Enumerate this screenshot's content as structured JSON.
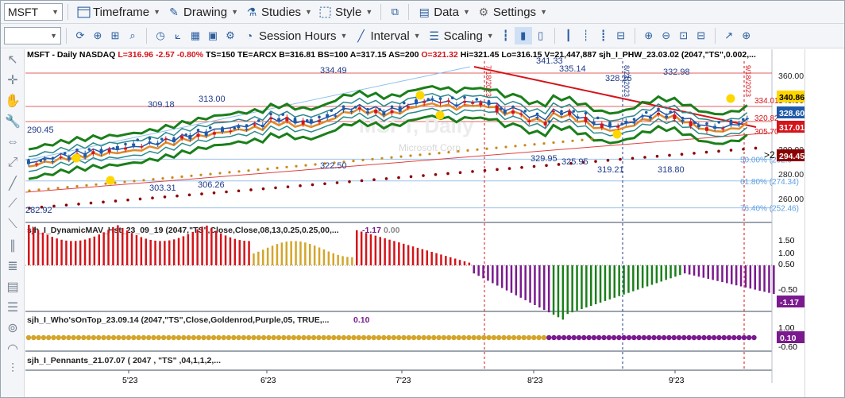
{
  "toolbar": {
    "symbol": "MSFT",
    "timeframe_label": "Timeframe",
    "drawing_label": "Drawing",
    "studies_label": "Studies",
    "style_label": "Style",
    "data_label": "Data",
    "settings_label": "Settings",
    "session_hours_label": "Session Hours",
    "interval_label": "Interval",
    "scaling_label": "Scaling"
  },
  "main_header": {
    "symbol": "MSFT - Daily  NASDAQ",
    "last": "L=316.96",
    "chg": "-2.57",
    "pct": "-0.80%",
    "ts": "TS=150",
    "te": "TE=ARCX",
    "bid": "B=316.81",
    "bs": "BS=100",
    "ask": "A=317.15",
    "as": "AS=200",
    "open": "O=321.32",
    "high": "Hi=321.45",
    "low": "Lo=316.15",
    "vol": "V=21,447,887",
    "study": "sjh_I_PHW_23.03.02 (2047,\"TS\",0.002,..."
  },
  "watermark": {
    "title": "MSFT, Daily",
    "subtitle": "Microsoft Corp"
  },
  "price_axis": {
    "ticks": [
      "360.00",
      "340.00",
      "320.00",
      "300.00",
      "280.00",
      "260.00"
    ],
    "badges": [
      {
        "text": "340.86",
        "bg": "#ffd700",
        "fg": "#000000"
      },
      {
        "text": "328.60",
        "bg": "#1e5aa8",
        "fg": "#ffffff"
      },
      {
        "text": "317.01",
        "bg": "#d4141a",
        "fg": "#ffffff"
      },
      {
        "text": "294.45",
        "bg": "#8b0000",
        "fg": "#ffffff"
      }
    ],
    "marker": ">2"
  },
  "price_annotations": [
    "334.49",
    "341.33",
    "335.14",
    "328.26",
    "332.98",
    "309.18",
    "313.00",
    "290.45",
    "322.50",
    "329.95",
    "325.95",
    "319.21",
    "318.80",
    "303.31",
    "306.26",
    "282.92",
    "334.01",
    "320.82",
    "305.70"
  ],
  "fib_levels": [
    {
      "pct": "50.00% (292.0",
      "color": "#5fa0e0"
    },
    {
      "pct": "61.80% (274.34)",
      "color": "#5fa0e0"
    },
    {
      "pct": "76.40% (252.46)",
      "color": "#5fa0e0"
    }
  ],
  "dates_vertical": [
    "7/18/2023",
    "8/21/2023",
    "9/18/2023"
  ],
  "pane2": {
    "header": "sjh_I_DynamicMAV_Hst_23_09_19 (2047,\"TS\",Close,Close,08,13,0.25,0.25,00,...",
    "value1": "-1.17",
    "value2": "0.00",
    "ticks": [
      "1.50",
      "1.00",
      "0.50",
      "-0.50"
    ],
    "badge": "-1.17"
  },
  "pane3": {
    "header": "sjh_I_Who'sOnTop_23.09.14 (2047,\"TS\",Close,Goldenrod,Purple,05,  TRUE,...",
    "value": "0.10",
    "ticks": [
      "1.00",
      "-0.60"
    ],
    "badge": "0.10"
  },
  "pane4": {
    "header": "sjh_I_Pennants_21.07.07 (  2047 ,  \"TS\" ,04,1,1,2,..."
  },
  "time_axis": [
    "5'23",
    "6'23",
    "7'23",
    "8'23",
    "9'23"
  ],
  "colors": {
    "up": "#1e5aa8",
    "down": "#d4141a",
    "green": "#1a7f1a",
    "gold": "#d4a52a",
    "purple": "#7a1a8e"
  }
}
